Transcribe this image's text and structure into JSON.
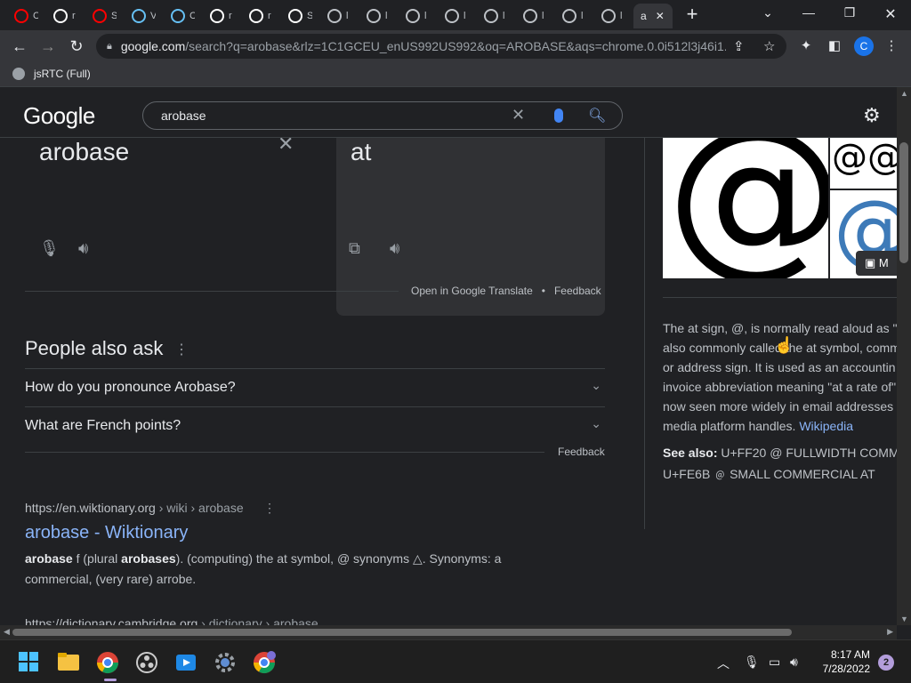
{
  "browser": {
    "tabs": [
      {
        "icon": "youtube-icon",
        "label": "C",
        "color": "#ff0000"
      },
      {
        "icon": "google-icon",
        "label": "r",
        "color": "#ffffff"
      },
      {
        "icon": "youtube-icon",
        "label": "S",
        "color": "#ff0000"
      },
      {
        "icon": "steam-icon",
        "label": "V",
        "color": "#66c0f4"
      },
      {
        "icon": "steam-icon",
        "label": "C",
        "color": "#66c0f4"
      },
      {
        "icon": "google-icon",
        "label": "r",
        "color": "#ffffff"
      },
      {
        "icon": "google-icon",
        "label": "r",
        "color": "#ffffff"
      },
      {
        "icon": "google-icon",
        "label": "S",
        "color": "#ffffff"
      },
      {
        "icon": "globe-icon",
        "label": "l",
        "color": "#bdc1c6"
      },
      {
        "icon": "globe-icon",
        "label": "l",
        "color": "#bdc1c6"
      },
      {
        "icon": "globe-icon",
        "label": "l",
        "color": "#bdc1c6"
      },
      {
        "icon": "globe-icon",
        "label": "l",
        "color": "#bdc1c6"
      },
      {
        "icon": "globe-icon",
        "label": "l",
        "color": "#bdc1c6"
      },
      {
        "icon": "globe-icon",
        "label": "l",
        "color": "#bdc1c6"
      },
      {
        "icon": "globe-icon",
        "label": "l",
        "color": "#bdc1c6"
      },
      {
        "icon": "globe-icon",
        "label": "l",
        "color": "#bdc1c6"
      }
    ],
    "active_tab": {
      "label": "a",
      "close": "✕"
    },
    "new_tab": "+",
    "url_host": "google.com",
    "url_rest": "/search?q=arobase&rlz=1C1GCEU_enUS992US992&oq=AROBASE&aqs=chrome.0.0i512l3j46i1...",
    "profile_initial": "C",
    "bookmark": "jsRTC (Full)"
  },
  "search": {
    "logo": "Google",
    "query": "arobase",
    "settings_icon": "gear-icon"
  },
  "translate": {
    "source_text": "arobase",
    "target_text": "at",
    "open_link": "Open in Google Translate",
    "separator": "•",
    "feedback": "Feedback"
  },
  "people_also_ask": {
    "title": "People also ask",
    "questions": [
      "How do you pronounce Arobase?",
      "What are French points?"
    ],
    "feedback": "Feedback"
  },
  "results": [
    {
      "cite_domain": "https://en.wiktionary.org",
      "cite_path": " › wiki › arobase",
      "title": "arobase - Wiktionary",
      "snippet_bold1": "arobase",
      "snippet_1": " f (plural ",
      "snippet_bold2": "arobases",
      "snippet_2": "). (computing) the at symbol, @ synonyms △. Synonyms: a commercial, (very rare) arrobe."
    },
    {
      "cite_domain": "https://dictionary.cambridge.org",
      "cite_path": " › dictionary › arobase"
    }
  ],
  "knowledge_panel": {
    "more_label": "M",
    "description_lines": [
      "The at sign, @, is normally read aloud as \"",
      "also commonly called the at symbol, comm",
      "or address sign. It is used as an accountin",
      "invoice abbreviation meaning \"at a rate of\"",
      "now seen more widely in email addresses",
      "media platform handles. "
    ],
    "wiki_link": "Wikipedia",
    "see_also_label": "See also:",
    "see_also_1": " U+FF20 @ FULLWIDTH COMM",
    "see_also_2": "U+FE6B ﹫ SMALL COMMERCIAL AT"
  },
  "taskbar": {
    "time": "8:17 AM",
    "date": "7/28/2022",
    "notifications": "2"
  }
}
